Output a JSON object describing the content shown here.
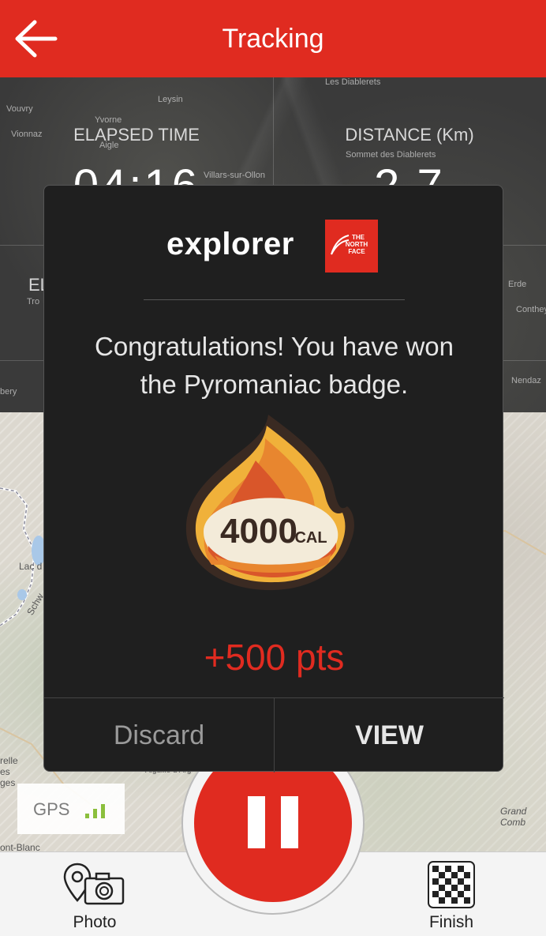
{
  "header": {
    "title": "Tracking",
    "back_icon": "arrow-left-icon"
  },
  "stats": {
    "elapsed_label": "ELAPSED TIME",
    "elapsed_value": "04:16",
    "distance_label": "DISTANCE (Km)",
    "distance_value": "2.7",
    "third_label_partial": "EL"
  },
  "map_background": {
    "labels": [
      "Les Diablerets",
      "Leysin",
      "Vouvry",
      "Yvorne",
      "Aigle",
      "Vionnaz",
      "Sommet des Diablerets",
      "Villars-sur-Ollon",
      "Erde",
      "Conthey",
      "Nendaz",
      "Lac d",
      "Schw",
      "relle",
      "es",
      "ges",
      "ont-Blanc",
      "Grand Comb",
      "Aiguille d Arg",
      "bery",
      "Tro"
    ]
  },
  "gps": {
    "label": "GPS",
    "signal_bars": 3,
    "signal_max": 4
  },
  "modal": {
    "brand": "explorer",
    "logo_text": "THE NORTH FACE",
    "message_line1": "Congratulations! You have won",
    "message_line2": "the Pyromaniac badge.",
    "badge_text_number": "4000",
    "badge_text_unit": "CAL",
    "points": "+500 pts",
    "discard_label": "Discard",
    "view_label": "VIEW"
  },
  "bottom": {
    "photo_label": "Photo",
    "finish_label": "Finish",
    "pause_icon": "pause-icon"
  },
  "colors": {
    "accent": "#e02b20",
    "modal_bg": "#1f1f1f",
    "gps_green": "#8bbf3d"
  }
}
